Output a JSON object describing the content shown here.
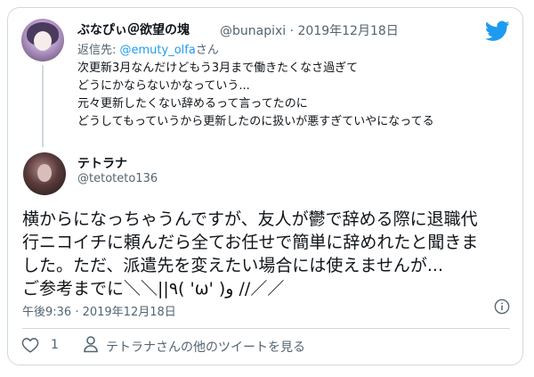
{
  "reply_tweet": {
    "display_name": "ぶなぴぃ＠欲望の塊",
    "handle_date": "@bunapixi · 2019年12月18日",
    "reply_prefix": "返信先: ",
    "reply_mention": "@emuty_olfa",
    "reply_suffix": "さん",
    "lines": [
      "次更新3月なんだけどもう3月まで働きたくなさ過ぎて",
      "どうにかならないかなっていう...",
      "元々更新したくない辞めるって言ってたのに",
      "どうしてもっていうから更新したのに扱いが悪すぎていやになってる"
    ]
  },
  "main_tweet": {
    "display_name": "テトラナ",
    "handle": "@tetoteto136",
    "lines": [
      "横からになっちゃうんですが、友人が鬱で辞める際に退職代",
      "行ニコイチに頼んだら全てお任せで簡単に辞めれたと聞きま",
      "した。ただ、派遣先を変えたい場合には使えませんが...",
      "ご参考までに＼＼||٩( 'ω' )و //／／"
    ],
    "timestamp": "午後9:36 · 2019年12月18日"
  },
  "footer": {
    "like_count": "1",
    "more_label": "テトラナさんの他のツイートを見る"
  },
  "icons": [
    "twitter-bird-icon",
    "info-icon",
    "heart-icon",
    "person-icon"
  ],
  "colors": {
    "accent": "#1d9bf0",
    "muted": "#536471",
    "border": "#cfd9de"
  }
}
